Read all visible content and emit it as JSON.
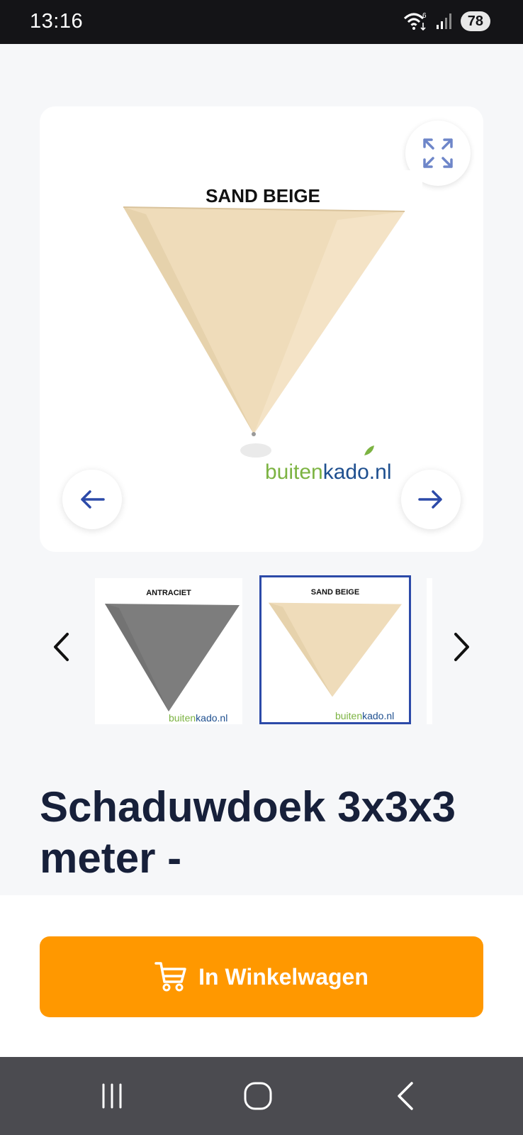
{
  "status_bar": {
    "time": "13:16",
    "battery": "78",
    "wifi_badge": "6"
  },
  "gallery": {
    "main_image": {
      "label": "SAND BEIGE",
      "brand_prefix": "buiten",
      "brand_suffix": "kado.nl",
      "fabric_color": "#efdcba"
    },
    "thumbnails": [
      {
        "label": "ANTRACIET",
        "brand_prefix": "buiten",
        "brand_suffix": "kado.nl",
        "fabric_color": "#7d7d7d",
        "selected": false
      },
      {
        "label": "SAND BEIGE",
        "brand_prefix": "buiten",
        "brand_suffix": "kado.nl",
        "fabric_color": "#efdcba",
        "selected": true
      }
    ],
    "icons": {
      "expand": "expand-icon",
      "prev": "arrow-left-icon",
      "next": "arrow-right-icon",
      "thumb_prev": "chevron-left-icon",
      "thumb_next": "chevron-right-icon"
    }
  },
  "product": {
    "title": "Schaduwdoek 3x3x3 meter -"
  },
  "cta": {
    "label": "In Winkelwagen",
    "icon": "cart-icon",
    "color": "#ff9800"
  },
  "colors": {
    "accent_blue": "#2c4aa8",
    "title_color": "#17203a",
    "brand_green": "#7cb342",
    "brand_blue": "#1e4f8f"
  }
}
